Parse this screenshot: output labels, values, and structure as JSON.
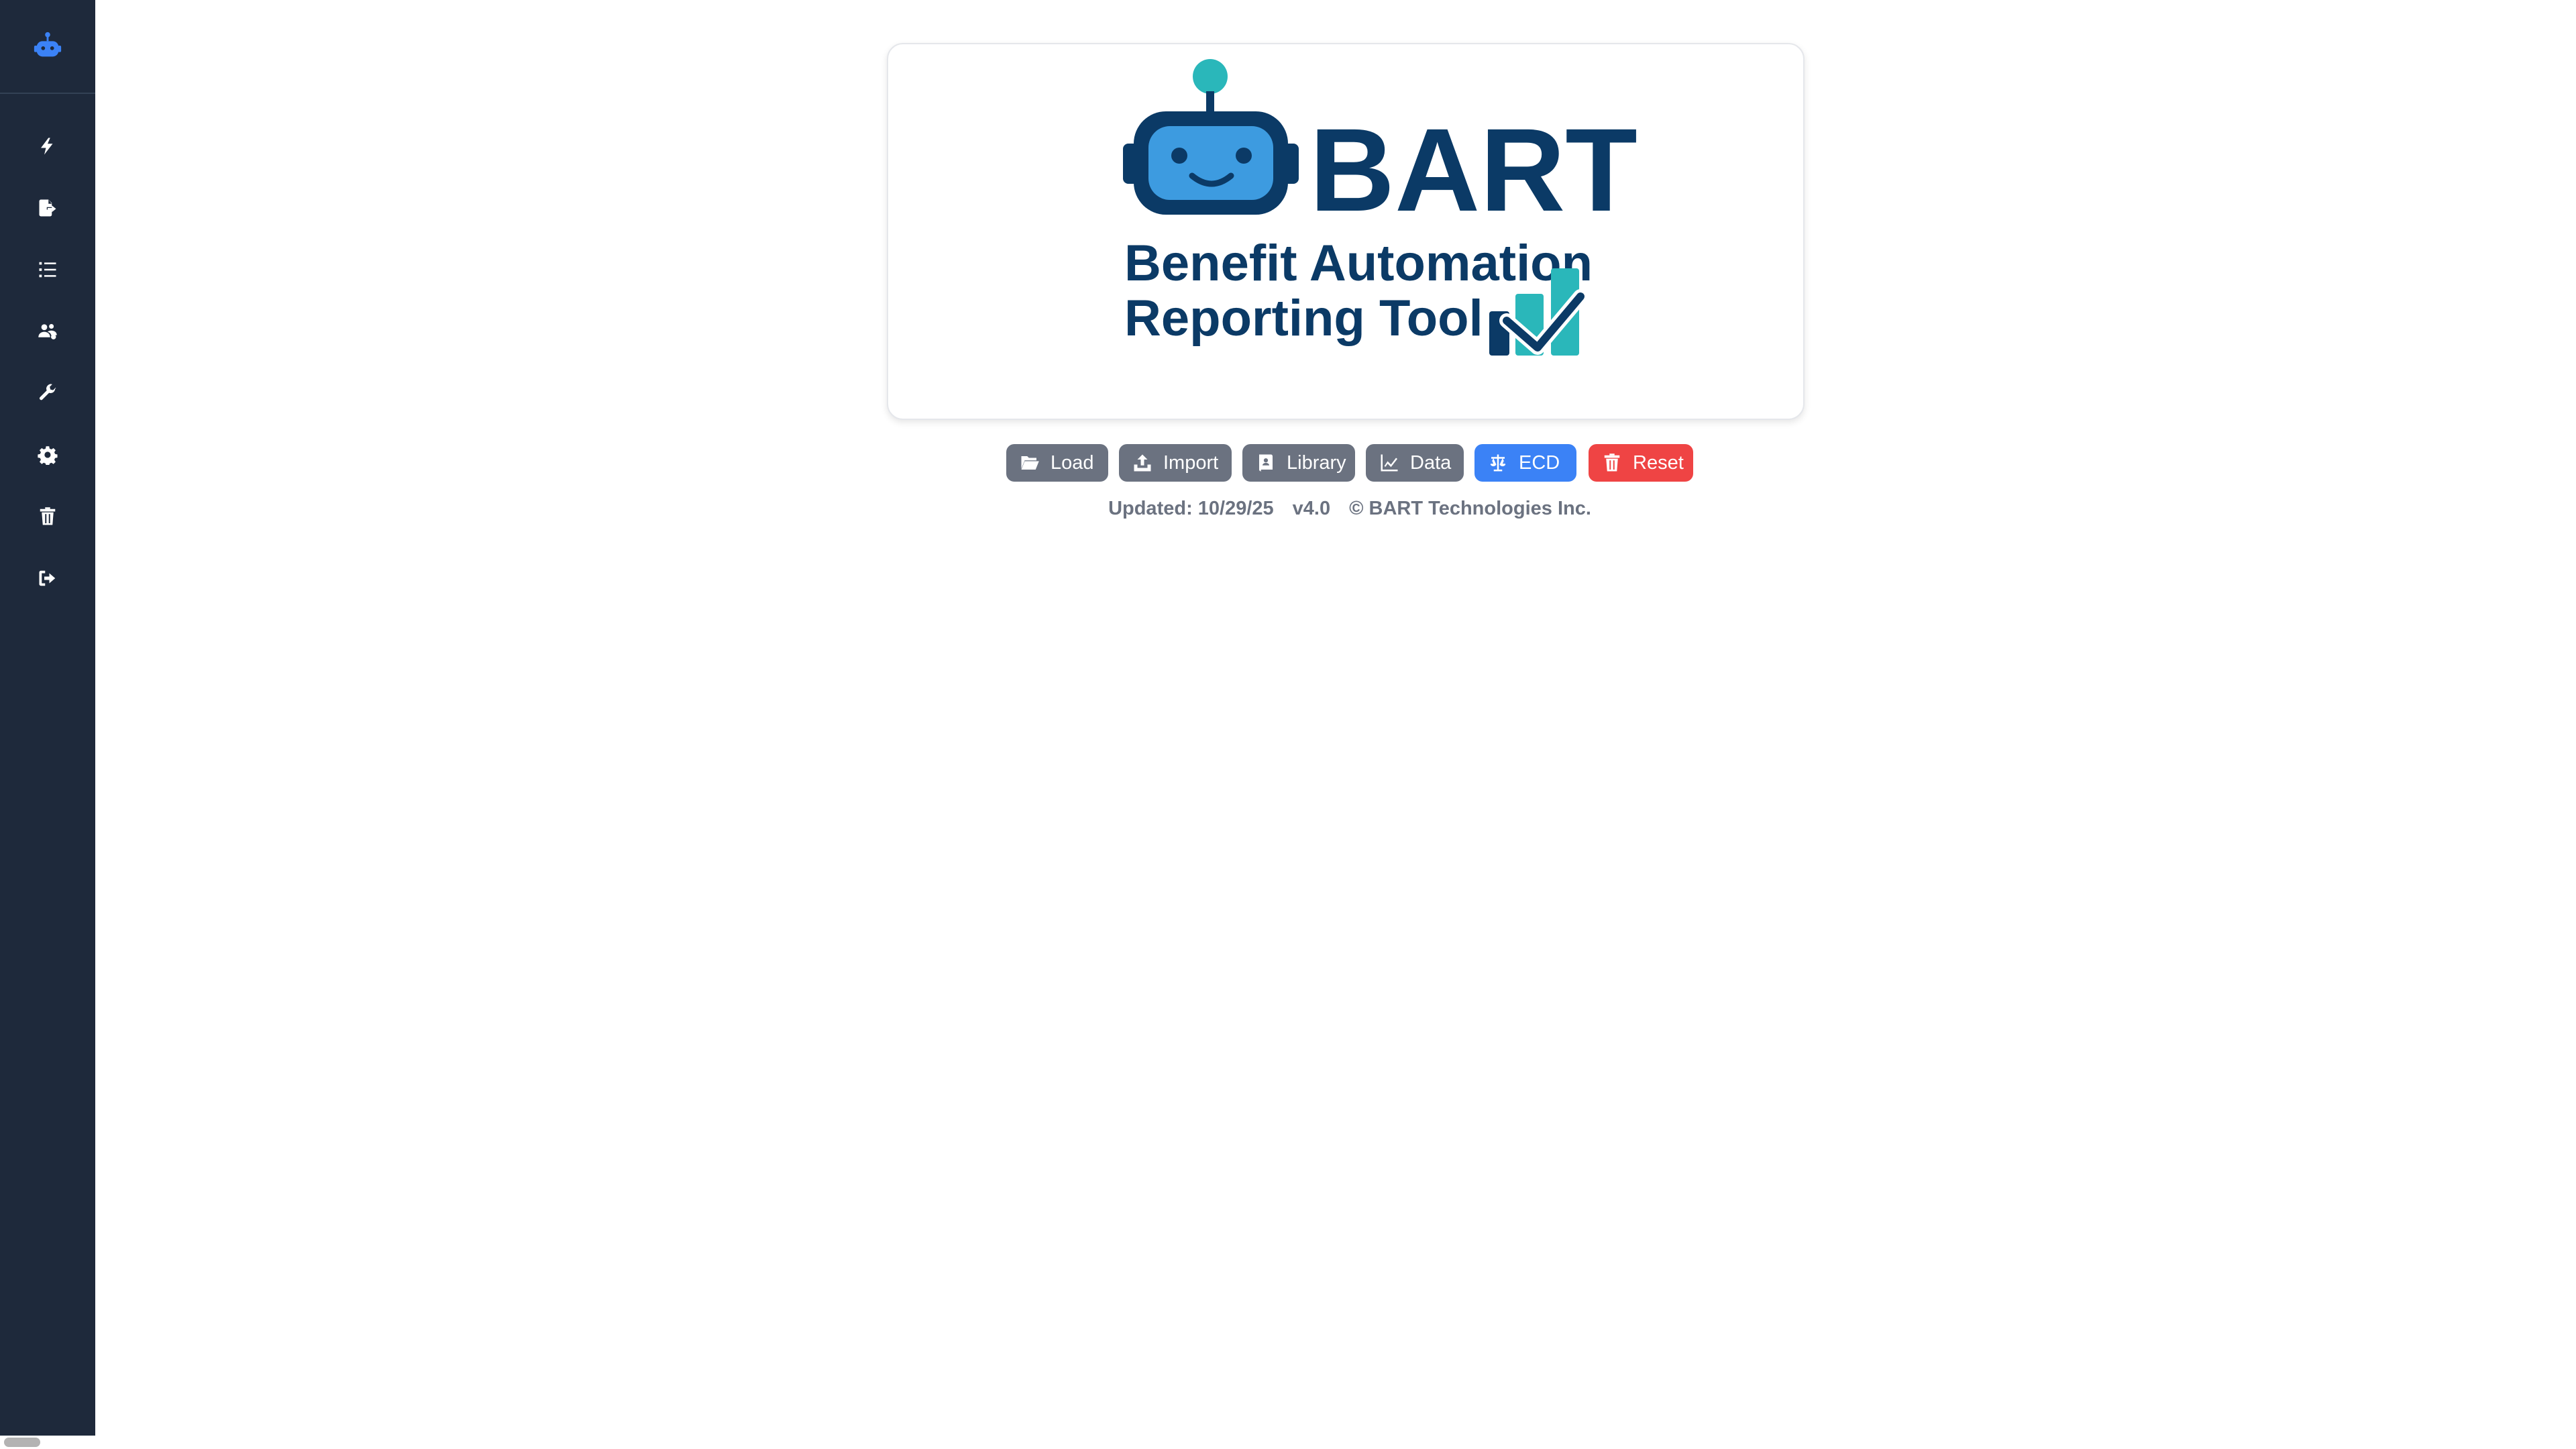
{
  "sidebar": {
    "logo_icon": "robot-icon",
    "items": [
      {
        "icon": "bolt-icon"
      },
      {
        "icon": "file-export-icon"
      },
      {
        "icon": "list-ol-icon"
      },
      {
        "icon": "users-cog-icon"
      },
      {
        "icon": "wrench-icon"
      },
      {
        "icon": "gear-icon"
      },
      {
        "icon": "trash-icon"
      },
      {
        "icon": "sign-out-icon"
      }
    ]
  },
  "logo": {
    "title": "BART",
    "subtitle_line1": "Benefit Automation",
    "subtitle_line2": "Reporting Tool"
  },
  "toolbar": {
    "buttons": [
      {
        "label": "Load",
        "icon": "folder-open-icon",
        "color": "#6b7280"
      },
      {
        "label": "Import",
        "icon": "upload-icon",
        "color": "#6b7280"
      },
      {
        "label": "Library",
        "icon": "book-icon",
        "color": "#6b7280"
      },
      {
        "label": "Data",
        "icon": "line-chart-icon",
        "color": "#6b7280"
      },
      {
        "label": "ECD",
        "icon": "balance-scale-icon",
        "color": "#3b82f6"
      },
      {
        "label": "Reset",
        "icon": "trash-icon",
        "color": "#ef4444"
      }
    ]
  },
  "footer": {
    "updated": "Updated: 10/29/25",
    "version": "v4.0",
    "copyright": "© BART Technologies Inc."
  },
  "colors": {
    "sidebar_bg": "#1e293b",
    "brand_navy": "#0b3a66",
    "brand_blue": "#3b82f6",
    "teal": "#2ab7ba",
    "danger": "#ef4444",
    "button_gray": "#6b7280"
  }
}
